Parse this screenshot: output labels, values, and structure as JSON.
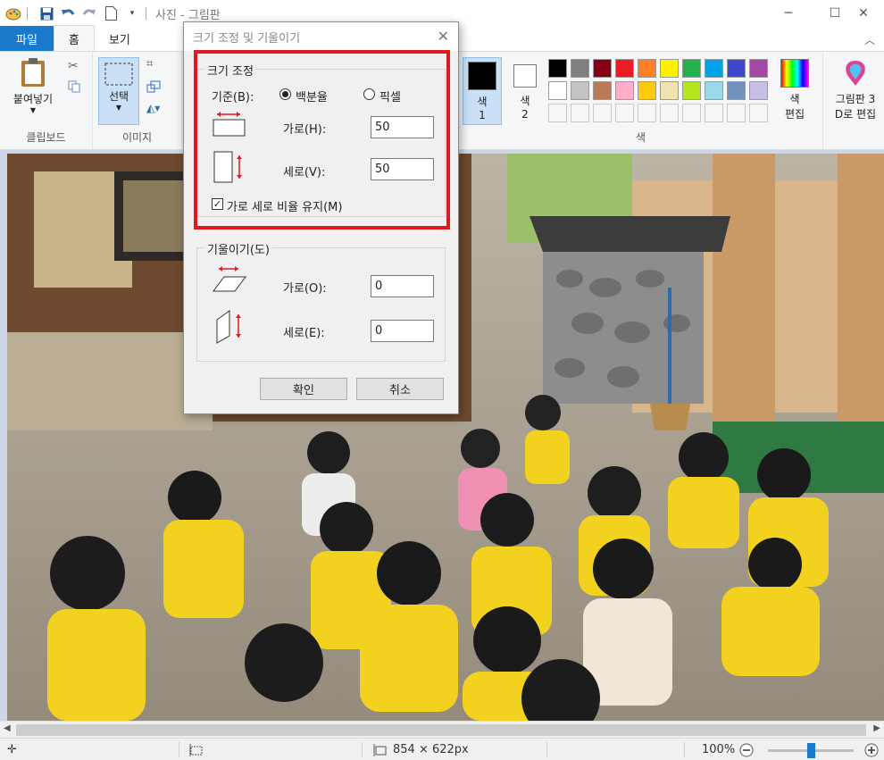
{
  "titlebar": {
    "title": "사진 - 그림판",
    "quick_access_icons": [
      "paint-app-icon",
      "save-icon",
      "undo-icon",
      "redo-icon",
      "new-page-icon",
      "customize-dropdown-icon"
    ],
    "window_buttons": {
      "minimize": "─",
      "maximize": "☐",
      "close": "✕"
    }
  },
  "tabs": {
    "file": "파일",
    "home": "홈",
    "view": "보기"
  },
  "ribbon": {
    "clipboard": {
      "paste_label": "붙여넣기",
      "group_label": "클립보드"
    },
    "image": {
      "select_label": "선택",
      "group_label": "이미지"
    },
    "colors": {
      "color1_label": "색",
      "color1_number": "1",
      "color2_label": "색",
      "color2_number": "2",
      "edit_colors_line1": "색",
      "edit_colors_line2": "편집",
      "group_label": "색",
      "color1_value": "#000000",
      "color2_value": "#ffffff",
      "palette_row1": [
        "#000000",
        "#7f7f7f",
        "#880015",
        "#ed1c24",
        "#ff7f27",
        "#fff200",
        "#22b14c",
        "#00a2e8",
        "#3f48cc",
        "#a349a4"
      ],
      "palette_row2": [
        "#ffffff",
        "#c3c3c3",
        "#b97a57",
        "#ffaec9",
        "#ffc90e",
        "#efe4b0",
        "#b5e61d",
        "#99d9ea",
        "#7092be",
        "#c8bfe7"
      ]
    },
    "paint3d": {
      "line1": "그림판 3",
      "line2": "D로 편집"
    }
  },
  "dialog": {
    "title": "크기 조정 및 기울이기",
    "resize": {
      "legend": "크기 조정",
      "basis_label": "기준(B):",
      "percent_label": "백분율",
      "pixel_label": "픽셀",
      "basis_selected": "백분율",
      "horizontal_label": "가로(H):",
      "horizontal_value": "50",
      "vertical_label": "세로(V):",
      "vertical_value": "50",
      "keep_ratio_label": "가로 세로 비율 유지(M)",
      "keep_ratio_checked": true
    },
    "skew": {
      "legend": "기울이기(도)",
      "horizontal_label": "가로(O):",
      "horizontal_value": "0",
      "vertical_label": "세로(E):",
      "vertical_value": "0"
    },
    "ok_label": "확인",
    "cancel_label": "취소",
    "highlight_color": "#e0191f"
  },
  "status": {
    "image_size": "854 × 622px",
    "zoom": "100%",
    "zoom_slider_level": 0.5
  }
}
